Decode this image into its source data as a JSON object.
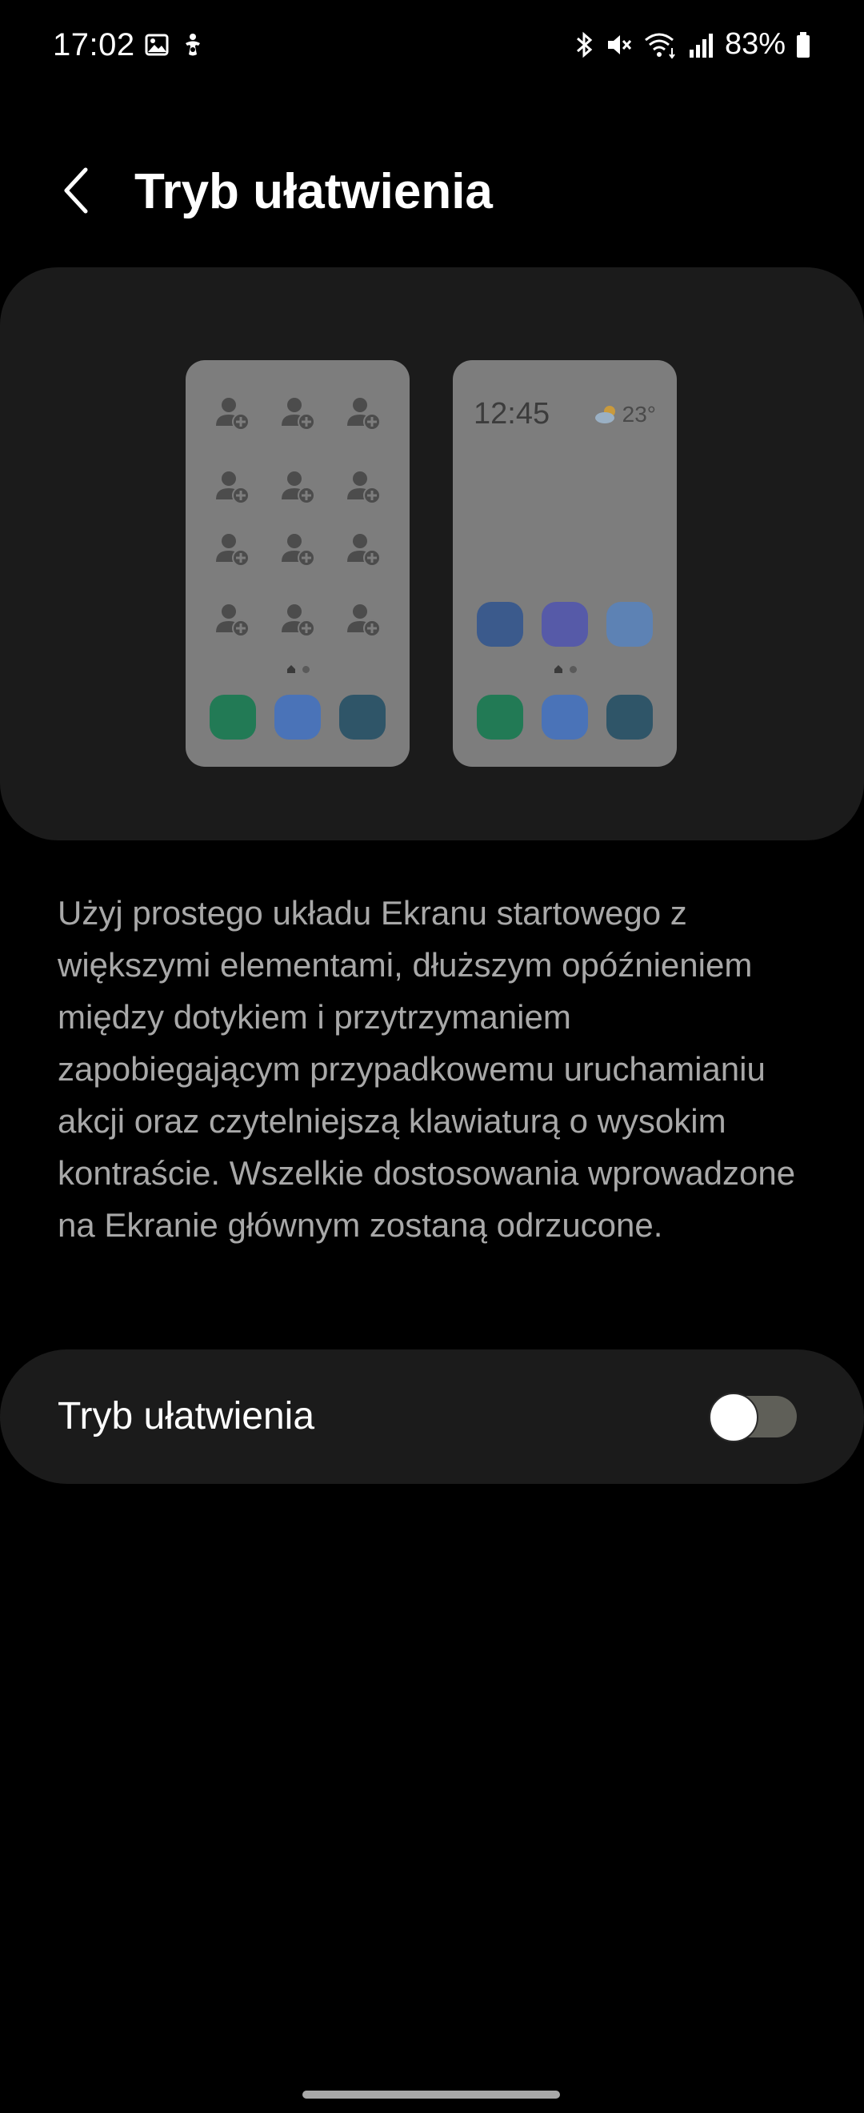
{
  "status_bar": {
    "time": "17:02",
    "battery_percent": "83%",
    "left_icons": [
      "gallery-icon",
      "accessibility-icon"
    ],
    "right_icons": [
      "bluetooth-icon",
      "mute-icon",
      "wifi-icon",
      "signal-icon",
      "battery-icon"
    ]
  },
  "header": {
    "title": "Tryb ułatwienia",
    "back_icon": "chevron-left-icon"
  },
  "preview": {
    "easy_phone": {
      "clock": "12:45",
      "weather_temp": "23°"
    },
    "colors": {
      "card": "#1b1b1b",
      "phone": "#7d7d7d",
      "green": "#227a55",
      "blue": "#4a73b8",
      "teal": "#2f5568",
      "navy": "#3b5a8c",
      "purple": "#565aa8",
      "light_blue": "#5d82b4"
    }
  },
  "description": "Użyj prostego układu Ekranu startowego z większymi elementami, dłuższym opóźnieniem między dotykiem i przytrzymaniem zapobiegającym przypadkowemu uruchamianiu akcji oraz czytelniejszą klawiaturą o wysokim kontraście. Wszelkie dostosowania wprowadzone na Ekranie głównym zostaną odrzucone.",
  "easy_mode_toggle": {
    "label": "Tryb ułatwienia",
    "enabled": false
  }
}
